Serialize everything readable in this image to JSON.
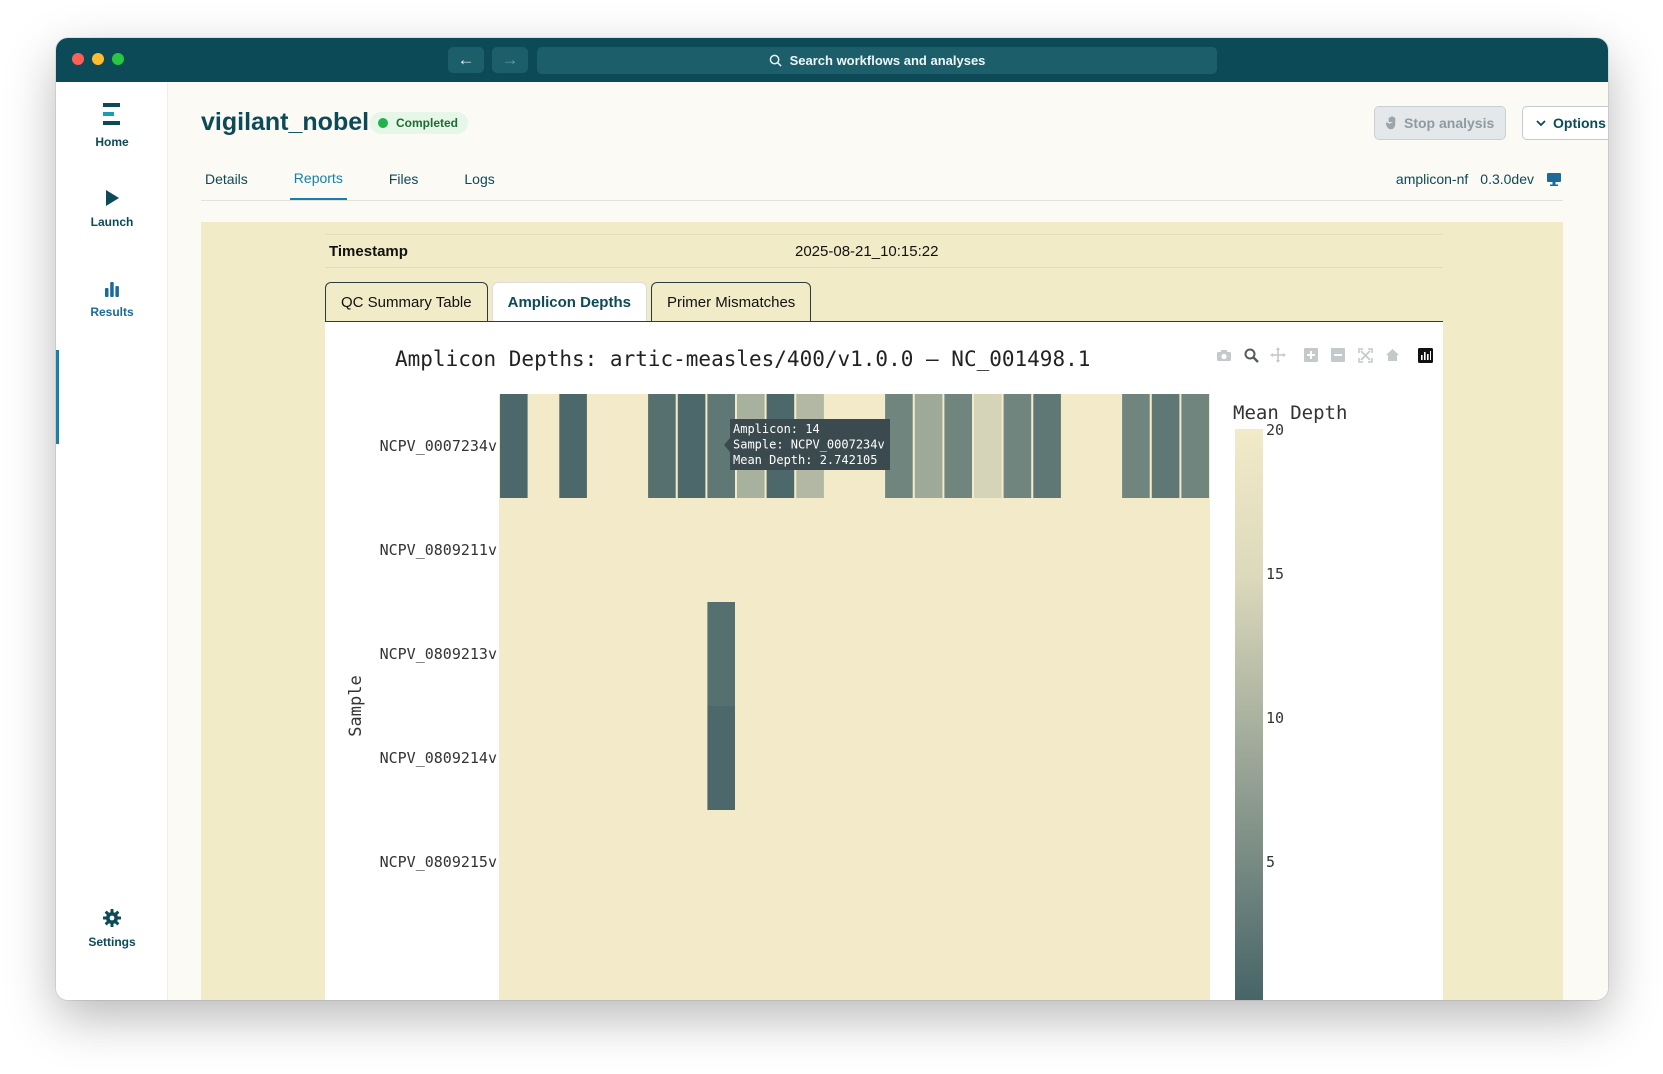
{
  "titlebar": {
    "search_placeholder": "Search workflows and analyses",
    "back_icon": "arrow-left-icon",
    "forward_icon": "arrow-right-icon"
  },
  "sidebar": {
    "items": [
      {
        "label": "Home",
        "icon": "logo-icon"
      },
      {
        "label": "Launch",
        "icon": "play-icon"
      },
      {
        "label": "Results",
        "icon": "bar-chart-icon"
      },
      {
        "label": "Settings",
        "icon": "gear-icon"
      }
    ],
    "active": "Results"
  },
  "header": {
    "title": "vigilant_nobel",
    "status": "Completed",
    "stop_label": "Stop analysis",
    "options_label": "Options",
    "pipeline_name": "amplicon-nf",
    "pipeline_version": "0.3.0dev"
  },
  "tabs": [
    {
      "label": "Details"
    },
    {
      "label": "Reports"
    },
    {
      "label": "Files"
    },
    {
      "label": "Logs"
    }
  ],
  "active_tab": "Reports",
  "report": {
    "timestamp_label": "Timestamp",
    "timestamp_value": "2025-08-21_10:15:22",
    "tabs": [
      {
        "label": "QC Summary Table"
      },
      {
        "label": "Amplicon Depths"
      },
      {
        "label": "Primer Mismatches"
      }
    ],
    "active_tab": "Amplicon Depths"
  },
  "colors": {
    "brand": "#0c4a57",
    "accent": "#1a7fa8",
    "heat_high": "#f2eac8",
    "heat_low": "#3a5a60"
  },
  "chart_data": {
    "type": "heatmap",
    "title": "Amplicon Depths: artic-measles/400/v1.0.0 – NC_001498.1",
    "ylabel": "Sample",
    "colorbar_title": "Mean Depth",
    "colorbar_ticks": [
      20,
      15,
      10,
      5
    ],
    "zlim": [
      0,
      20
    ],
    "amplicon_count": 24,
    "samples": [
      "NCPV_0007234v",
      "NCPV_0809211v",
      "NCPV_0809213v",
      "NCPV_0809214v",
      "NCPV_0809215v"
    ],
    "z": [
      [
        2,
        20,
        2,
        20,
        20,
        3,
        2,
        4,
        12,
        2,
        13,
        20,
        20,
        6,
        11,
        6,
        17,
        6,
        4,
        20,
        20,
        6,
        4,
        6
      ],
      [
        20,
        20,
        20,
        20,
        20,
        20,
        20,
        20,
        20,
        20,
        20,
        20,
        20,
        20,
        20,
        20,
        20,
        20,
        20,
        20,
        20,
        20,
        20,
        20
      ],
      [
        20,
        20,
        20,
        20,
        20,
        20,
        20,
        3,
        20,
        20,
        20,
        20,
        20,
        20,
        20,
        20,
        20,
        20,
        20,
        20,
        20,
        20,
        20,
        20
      ],
      [
        20,
        20,
        20,
        20,
        20,
        20,
        20,
        2,
        20,
        20,
        20,
        20,
        20,
        20,
        20,
        20,
        20,
        20,
        20,
        20,
        20,
        20,
        20,
        20
      ],
      [
        20,
        20,
        20,
        20,
        20,
        20,
        20,
        20,
        20,
        20,
        20,
        20,
        20,
        20,
        20,
        20,
        20,
        20,
        20,
        20,
        20,
        20,
        20,
        20
      ]
    ],
    "tooltip": {
      "line1": "Amplicon: 14",
      "line2": "Sample: NCPV_0007234v",
      "line3": "Mean Depth: 2.742105"
    }
  }
}
